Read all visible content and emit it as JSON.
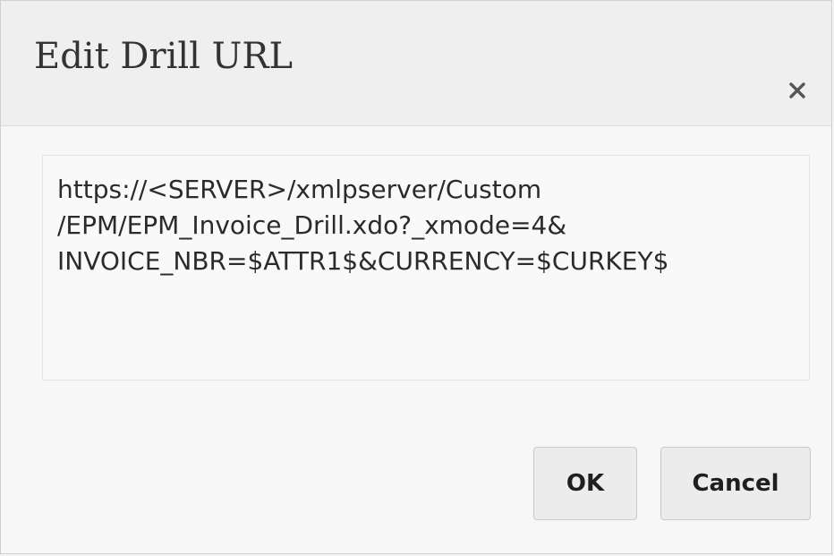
{
  "dialog": {
    "title": "Edit Drill URL",
    "close_icon": "close-icon",
    "url_value": "https://<SERVER>/xmlpserver/Custom\n/EPM/EPM_Invoice_Drill.xdo?_xmode=4&\nINVOICE_NBR=$ATTR1$&CURRENCY=$CURKEY$",
    "ok_label": "OK",
    "cancel_label": "Cancel"
  },
  "colors": {
    "header_bg": "#efefef",
    "body_bg": "#f7f7f7",
    "button_bg": "#ececec",
    "text": "#2b2b2b"
  }
}
